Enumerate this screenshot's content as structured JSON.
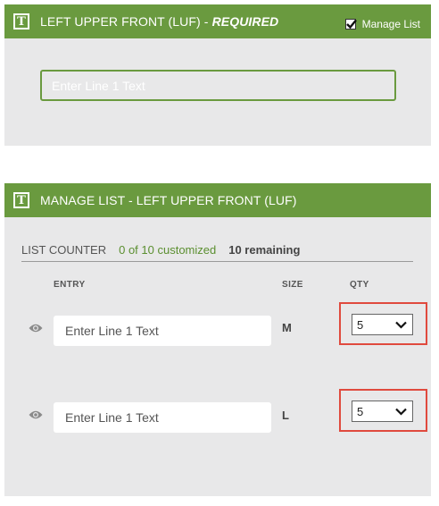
{
  "top_panel": {
    "title": "LEFT UPPER FRONT (LUF) - ",
    "required": "REQUIRED",
    "manage_list_label": "Manage List",
    "manage_list_checked": true,
    "line1_placeholder": "Enter Line 1 Text"
  },
  "manage_panel": {
    "title": "MANAGE LIST - LEFT UPPER FRONT (LUF)",
    "counter_label": "LIST COUNTER",
    "customized": "0 of 10 customized",
    "remaining": "10 remaining",
    "columns": {
      "entry": "ENTRY",
      "size": "SIZE",
      "qty": "QTY"
    },
    "rows": [
      {
        "placeholder": "Enter Line 1 Text",
        "size": "M",
        "qty": "5"
      },
      {
        "placeholder": "Enter Line 1 Text",
        "size": "L",
        "qty": "5"
      }
    ]
  },
  "colors": {
    "header_green": "#6a9a3f",
    "panel_bg": "#e8e8e9",
    "highlight_red": "#e04a3e",
    "customized_green": "#5b8f30"
  },
  "icons": {
    "header_icon": "text-t-icon",
    "row_icon": "eye-icon",
    "select_icon": "chevron-down-icon",
    "checkbox_icon": "checkmark-icon"
  }
}
